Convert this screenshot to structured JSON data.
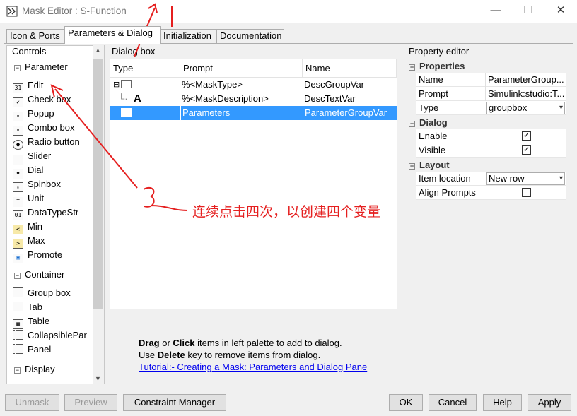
{
  "window": {
    "title": "Mask Editor : S-Function",
    "minimize": "—",
    "maximize": "☐",
    "close": "✕"
  },
  "tabs": [
    {
      "label": "Icon & Ports"
    },
    {
      "label": "Parameters & Dialog"
    },
    {
      "label": "Initialization"
    },
    {
      "label": "Documentation"
    }
  ],
  "controls": {
    "title": "Controls",
    "sections": [
      {
        "label": "Parameter",
        "items": [
          "Edit",
          "Check box",
          "Popup",
          "Combo box",
          "Radio button",
          "Slider",
          "Dial",
          "Spinbox",
          "Unit",
          "DataTypeStr",
          "Min",
          "Max",
          "Promote"
        ]
      },
      {
        "label": "Container",
        "items": [
          "Group box",
          "Tab",
          "Table",
          "CollapsiblePar",
          "Panel"
        ]
      },
      {
        "label": "Display",
        "items": []
      }
    ]
  },
  "dialog_box": {
    "title": "Dialog box",
    "columns": [
      "Type",
      "Prompt",
      "Name"
    ],
    "rows": [
      {
        "prompt": "%<MaskType>",
        "name": "DescGroupVar",
        "type_icon": "folder-icon",
        "expand": "⊟"
      },
      {
        "prompt": "%<MaskDescription>",
        "name": "DescTextVar",
        "type_icon": "text-icon",
        "type_glyph": "A"
      },
      {
        "prompt": "Parameters",
        "name": "ParameterGroupVar",
        "type_icon": "folder-icon",
        "selected": true
      }
    ],
    "help": {
      "drag": "Drag",
      "or": " or ",
      "click": "Click",
      "line1_rest": " items in left palette to add to dialog.",
      "use": "Use ",
      "delete": "Delete",
      "line2_rest": " key to remove items from dialog.",
      "tutorial_link": "Tutorial:- Creating a Mask: Parameters and Dialog Pane"
    }
  },
  "property_editor": {
    "title": "Property editor",
    "groups": [
      {
        "label": "Properties",
        "props": [
          {
            "name": "Name",
            "value": "ParameterGroup..."
          },
          {
            "name": "Prompt",
            "value": "Simulink:studio:T..."
          },
          {
            "name": "Type",
            "value": "groupbox",
            "kind": "combo"
          }
        ]
      },
      {
        "label": "Dialog",
        "props": [
          {
            "name": "Enable",
            "checked": true
          },
          {
            "name": "Visible",
            "checked": true
          }
        ]
      },
      {
        "label": "Layout",
        "props": [
          {
            "name": "Item location",
            "value": "New row",
            "kind": "combo"
          },
          {
            "name": "Align Prompts",
            "checked": false
          }
        ]
      }
    ]
  },
  "buttons": {
    "unmask": "Unmask",
    "preview": "Preview",
    "constraint_manager": "Constraint Manager",
    "ok": "OK",
    "cancel": "Cancel",
    "help": "Help",
    "apply": "Apply"
  },
  "annotation": {
    "text": "连续点击四次，以创建四个变量",
    "color": "#e51f1f"
  }
}
